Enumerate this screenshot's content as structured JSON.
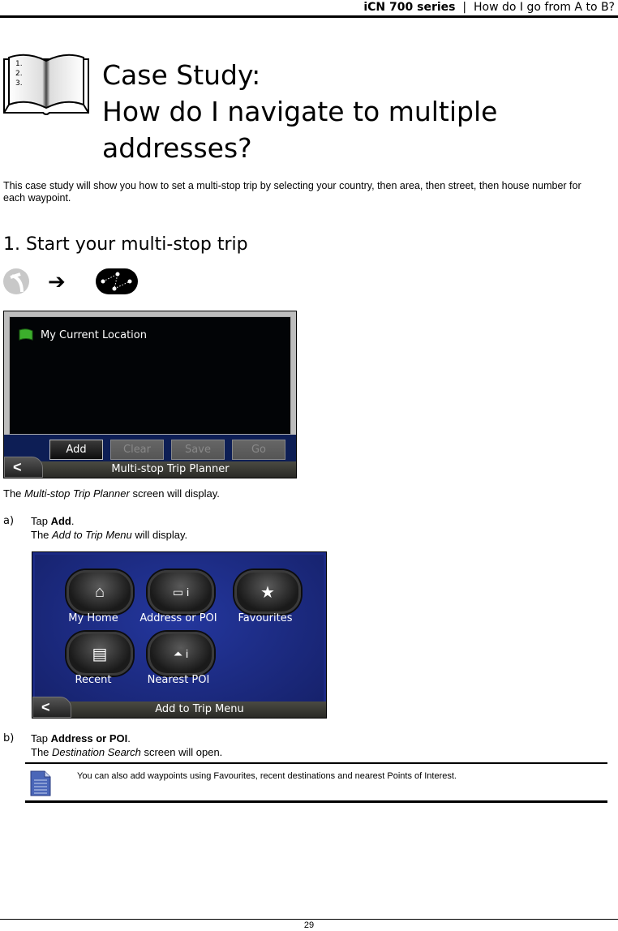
{
  "header": {
    "product": "iCN 700 series",
    "separator": "|",
    "section": "How do I go from A to B?"
  },
  "title": {
    "icon": "numbered-book-icon",
    "line1": "Case Study:",
    "line2": "How do I navigate to multiple",
    "line3": "addresses?"
  },
  "intro": "This case study will show you how to set a multi-stop trip by selecting your country, then area, then street, then house number for each waypoint.",
  "section1": {
    "heading": "1. Start your multi-stop trip",
    "icons": [
      "route-icon",
      "arrow-right-icon",
      "multi-stop-icon"
    ],
    "arrow": "➔"
  },
  "screen1": {
    "location_label": "My Current Location",
    "buttons": [
      {
        "label": "Add",
        "state": "active"
      },
      {
        "label": "Clear",
        "state": "disabled"
      },
      {
        "label": "Save",
        "state": "disabled"
      },
      {
        "label": "Go",
        "state": "disabled"
      }
    ],
    "back": "<",
    "footer_title": "Multi-stop Trip Planner"
  },
  "para1": {
    "pre": "The ",
    "em": "Multi-stop Trip Planner",
    "post": " screen will display."
  },
  "stepA": {
    "letter": "a)",
    "tap": "Tap ",
    "bold": "Add",
    "dot": ".",
    "line2_pre": "The ",
    "line2_em": "Add to Trip Menu",
    "line2_post": " will display."
  },
  "screen2": {
    "items": [
      {
        "label": "My Home",
        "icon": "house-icon",
        "glyph": "⌂"
      },
      {
        "label": "Address or POI",
        "icon": "address-poi-icon",
        "glyph": "▭ i"
      },
      {
        "label": "Favourites",
        "icon": "star-icon",
        "glyph": "★"
      },
      {
        "label": "Recent",
        "icon": "recent-cards-icon",
        "glyph": "▤"
      },
      {
        "label": "Nearest POI",
        "icon": "nearest-poi-icon",
        "glyph": "⏶ i"
      }
    ],
    "back": "<",
    "footer_title": "Add to Trip Menu"
  },
  "stepB": {
    "letter": "b)",
    "tap": "Tap ",
    "bold": "Address or POI",
    "dot": ".",
    "line2_pre": "The ",
    "line2_em": "Destination Search",
    "line2_post": " screen will open."
  },
  "note": {
    "icon": "note-document-icon",
    "text": "You can also add waypoints using Favourites, recent destinations and nearest Points of Interest."
  },
  "page_number": "29"
}
